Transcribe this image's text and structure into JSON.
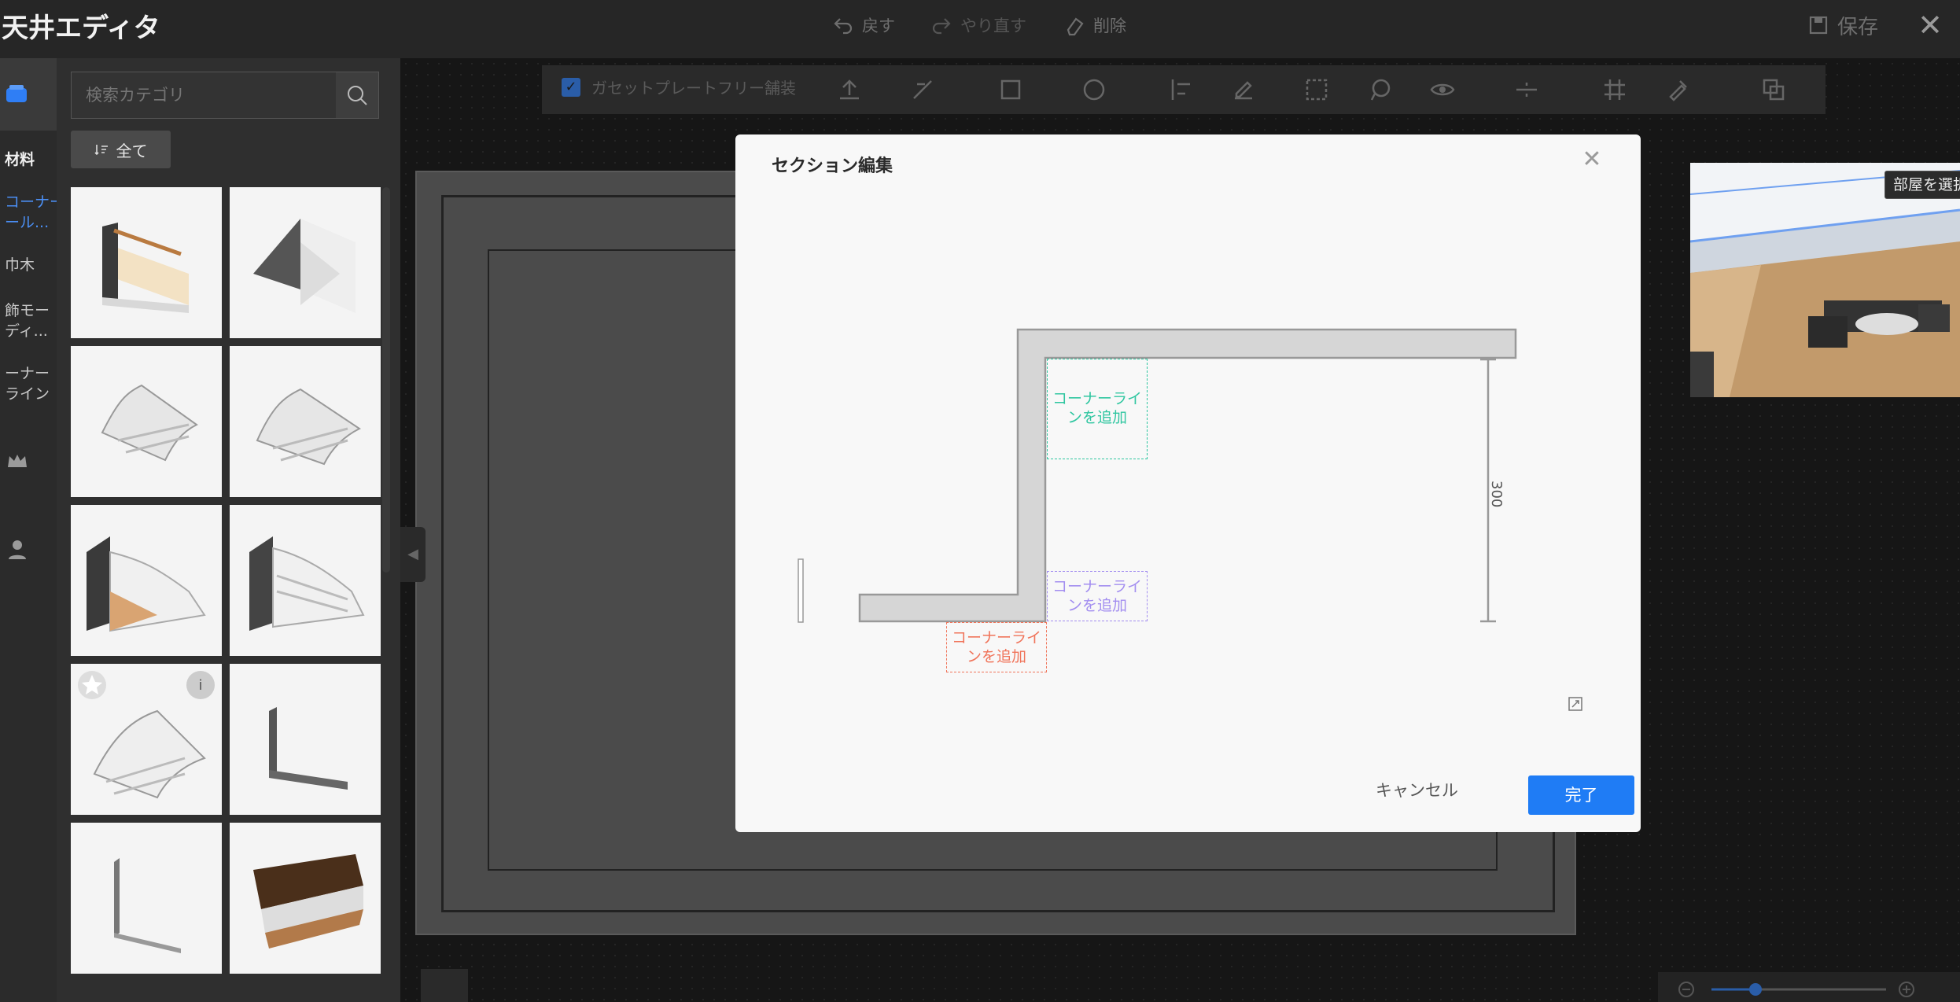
{
  "app": {
    "title": "天井エディタ"
  },
  "topbar": {
    "undo_label": "戻す",
    "redo_label": "やり直す",
    "delete_label": "削除",
    "save_label": "保存"
  },
  "rail": {
    "items": [
      {
        "label": "材料"
      },
      {
        "label": "コーナー\nール..."
      },
      {
        "label": "巾木"
      },
      {
        "label": "飾モー\nディ..."
      },
      {
        "label": "ーナー\nライン"
      }
    ]
  },
  "panel": {
    "search_placeholder": "検索カテゴリ",
    "filter_label": "全て"
  },
  "toolbar": {
    "checkbox_label": "ガセットプレートフリー舗装"
  },
  "preview": {
    "select_room_label": "部屋を選択"
  },
  "modal": {
    "title": "セクション編集",
    "add_corner_green": "コーナーライ\nンを追加",
    "add_corner_purple": "コーナーライ\nンを追加",
    "add_corner_red": "コーナーライ\nンを追加",
    "dimension": "300",
    "cancel_label": "キャンセル",
    "done_label": "完了"
  },
  "colors": {
    "accent": "#1f7cf5",
    "add_green": "#2fc6a0",
    "add_purple": "#a38ef0",
    "add_red": "#f0745a"
  }
}
